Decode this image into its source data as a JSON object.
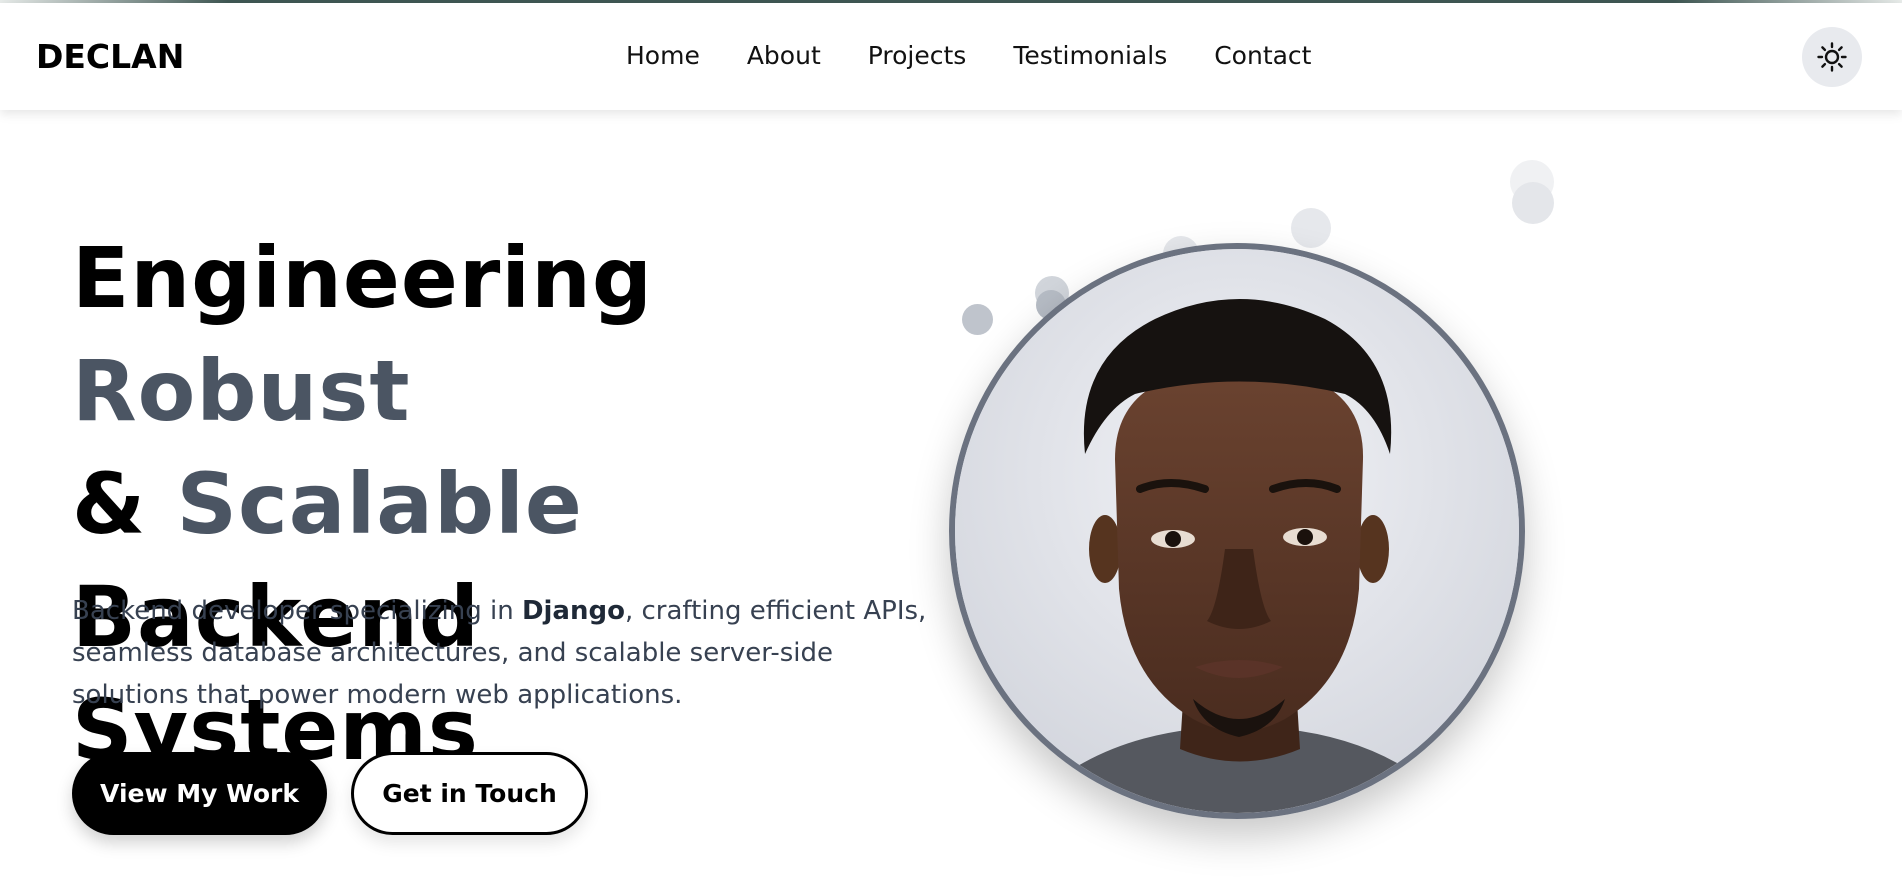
{
  "nav": {
    "logo": "DECLAN",
    "links": [
      {
        "label": "Home"
      },
      {
        "label": "About"
      },
      {
        "label": "Projects"
      },
      {
        "label": "Testimonials"
      },
      {
        "label": "Contact"
      }
    ],
    "theme_toggle_icon": "sun-icon"
  },
  "hero": {
    "title": {
      "part1": "Engineering ",
      "accent1": "Robust",
      "part2": "& ",
      "accent2": "Scalable",
      "part3": " Backend",
      "part4": "Systems"
    },
    "description": {
      "before": "Backend developer specializing in ",
      "highlight": "Django",
      "after": ", crafting efficient APIs, seamless database architectures, and scalable server-side solutions that power modern web applications."
    },
    "primary_button": "View My Work",
    "secondary_button": "Get in Touch",
    "portrait_icon": "profile-photo"
  },
  "colors": {
    "accent": "#4b5563",
    "primary_button_bg": "#000000",
    "portrait_border": "#6b7280"
  }
}
